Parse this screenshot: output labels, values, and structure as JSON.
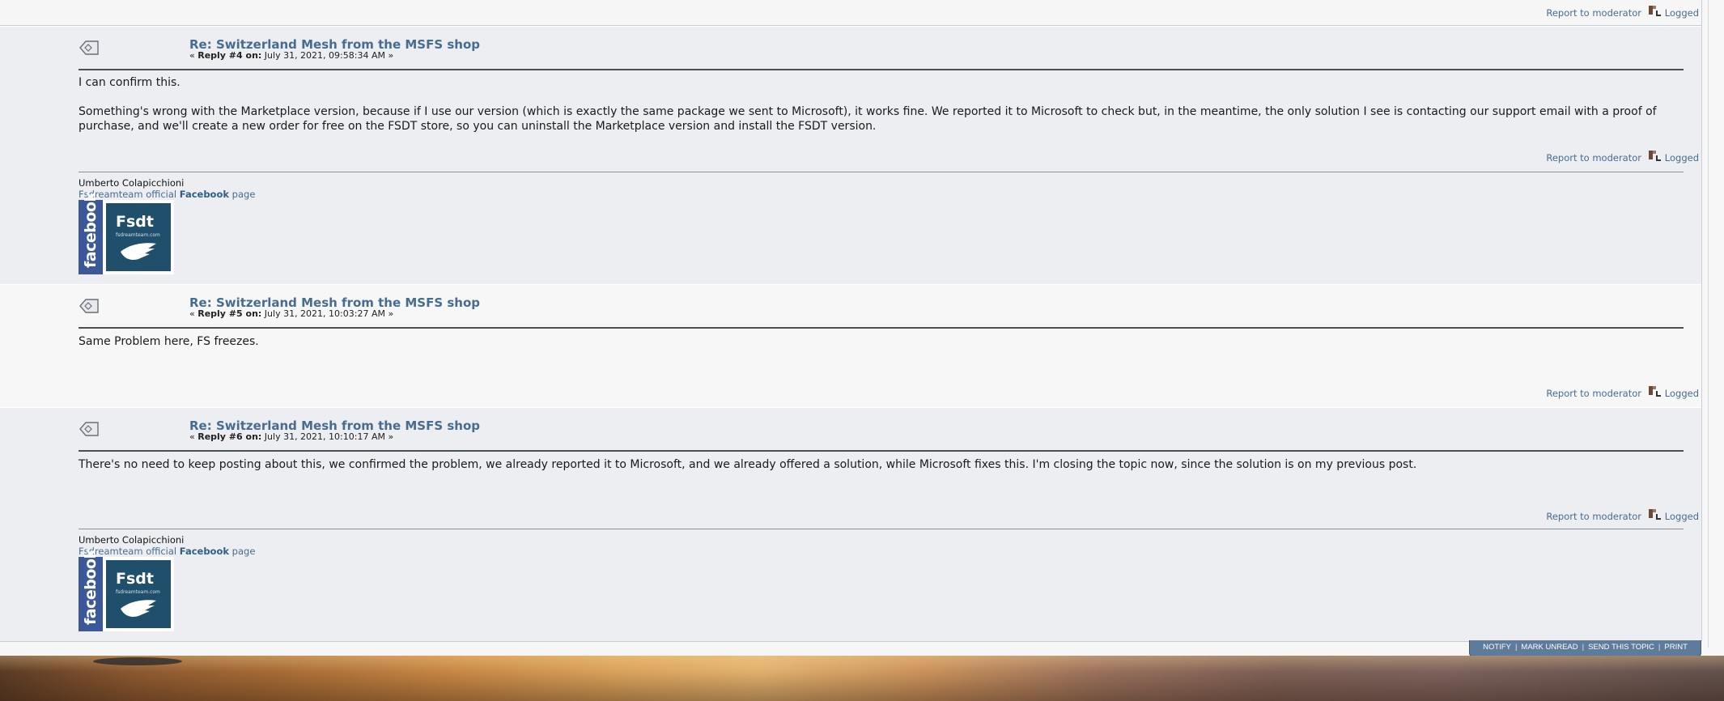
{
  "post_actions": {
    "report_label": "Report to moderator",
    "logged_label": "Logged"
  },
  "posts": [
    {
      "title": "Re: Switzerland Mesh from the MSFS shop",
      "reply_prefix": "« ",
      "reply_label": "Reply #4 on:",
      "date": " July 31, 2021, 09:58:34 AM »",
      "body": [
        "I can confirm this.",
        "Something's wrong with the Marketplace version, because if I use our version (which is exactly the same package we sent to Microsoft), it works fine. We reported it to Microsoft to check but, in the meantime, the only solution I see is contacting our support email with a proof of purchase, and we'll create a new order for free on the FSDT store, so you can uninstall the Marketplace version and install the FSDT version."
      ]
    },
    {
      "title": "Re: Switzerland Mesh from the MSFS shop",
      "reply_prefix": "« ",
      "reply_label": "Reply #5 on:",
      "date": " July 31, 2021, 10:03:27 AM »",
      "body": [
        "Same Problem here, FS freezes."
      ]
    },
    {
      "title": "Re: Switzerland Mesh from the MSFS shop",
      "reply_prefix": "« ",
      "reply_label": "Reply #6 on:",
      "date": " July 31, 2021, 10:10:17 AM »",
      "body": [
        "There's no need to keep posting about this, we confirmed the problem, we already reported it to Microsoft, and we already offered a solution, while Microsoft fixes this. I'm closing the topic now, since the solution is on my previous post."
      ]
    }
  ],
  "signature": {
    "name": "Umberto Colapicchioni",
    "line_prefix": "Fsdreamteam official ",
    "line_link": "Facebook",
    "line_suffix": " page",
    "banner_facebook": "facebook",
    "banner_brand": "Fsdt",
    "banner_url": "fsdreamteam.com"
  },
  "bottom_bar": {
    "notify": "NOTIFY",
    "mark_unread": "MARK UNREAD",
    "send_topic": "SEND THIS TOPIC",
    "print": "PRINT",
    "separator": "|"
  },
  "colors": {
    "link": "#476c8e",
    "post_alt_bg": "#eceef2",
    "post_plain_bg": "#f7f7f7",
    "button_bar": "#5f7b9b",
    "facebook_blue": "#3b5998",
    "fsdt_teal": "#1f4f6a"
  },
  "icons": {
    "post_icon": "xx-post-icon",
    "logged_icon": "ip-logged-icon",
    "wing_icon": "fsdt-wing-icon"
  }
}
